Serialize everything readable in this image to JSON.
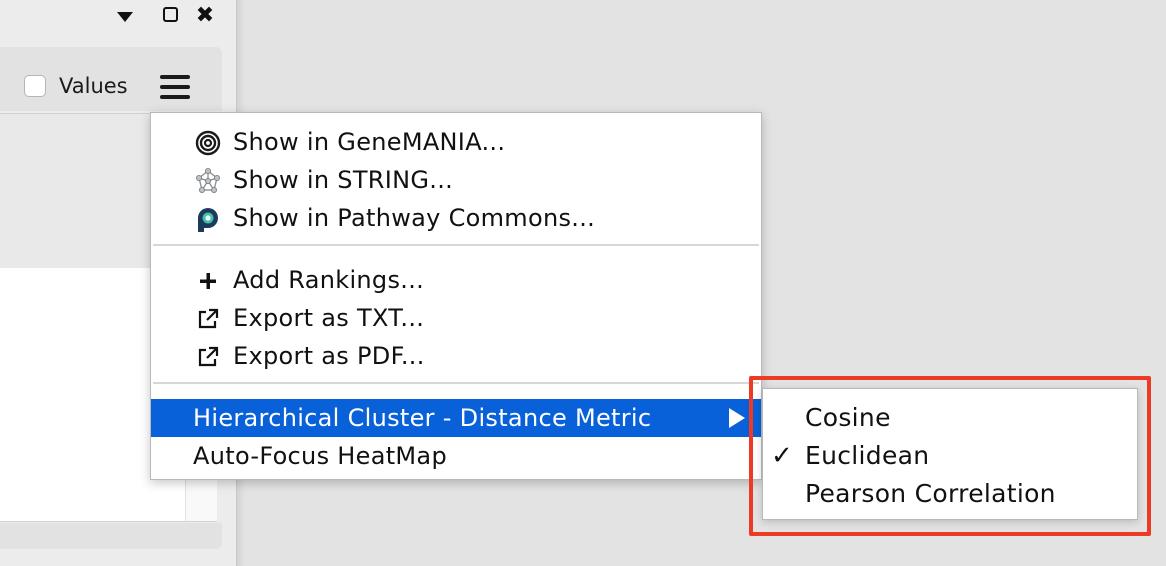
{
  "window": {
    "controls": [
      "chevron-down-icon",
      "maximize-icon",
      "close-icon"
    ],
    "close_glyph": "✖"
  },
  "toolbar": {
    "values_checkbox_checked": false,
    "values_label": "Values",
    "menu_icon": "hamburger-icon"
  },
  "menu": {
    "items": [
      {
        "label": "Show in GeneMANIA...",
        "icon": "genemania-icon"
      },
      {
        "label": "Show in STRING...",
        "icon": "string-icon"
      },
      {
        "label": "Show in Pathway Commons...",
        "icon": "pathway-commons-icon"
      },
      {
        "label": "Add Rankings...",
        "icon": "plus-icon"
      },
      {
        "label": "Export as TXT...",
        "icon": "export-icon"
      },
      {
        "label": "Export as PDF...",
        "icon": "export-icon"
      },
      {
        "label": "Hierarchical Cluster - Distance Metric",
        "icon": "submenu-arrow-icon",
        "highlighted": true
      },
      {
        "label": "Auto-Focus HeatMap"
      }
    ]
  },
  "submenu": {
    "items": [
      {
        "label": "Cosine",
        "checked": false
      },
      {
        "label": "Euclidean",
        "checked": true
      },
      {
        "label": "Pearson Correlation",
        "checked": false
      }
    ],
    "check_glyph": "✓"
  },
  "colors": {
    "highlight": "#0861d9",
    "annotation_box": "#ee3a25",
    "background": "#e3e3e3"
  }
}
